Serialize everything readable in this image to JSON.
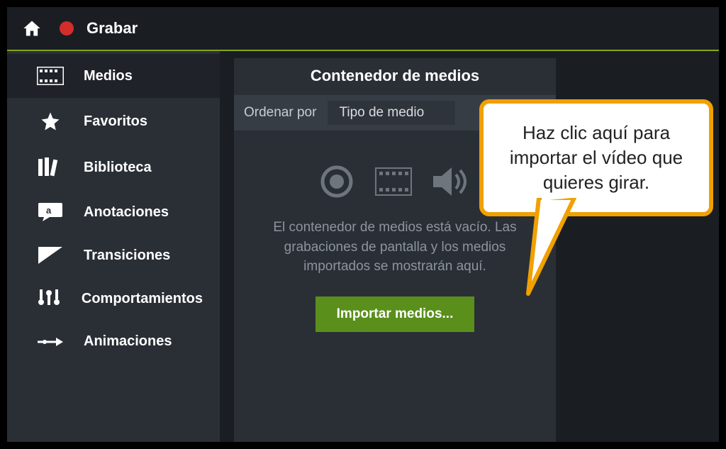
{
  "topbar": {
    "record_label": "Grabar"
  },
  "sidebar": {
    "items": [
      {
        "label": "Medios"
      },
      {
        "label": "Favoritos"
      },
      {
        "label": "Biblioteca"
      },
      {
        "label": "Anotaciones"
      },
      {
        "label": "Transiciones"
      },
      {
        "label": "Comportamientos"
      },
      {
        "label": "Animaciones"
      }
    ]
  },
  "panel": {
    "title": "Contenedor de medios",
    "sort_label": "Ordenar por",
    "sort_value": "Tipo de medio",
    "empty_text": "El contenedor de medios está vacío. Las grabaciones de pantalla y los medios importados se mostrarán aquí.",
    "import_button": "Importar medios..."
  },
  "callout": {
    "text": "Haz clic aquí para importar el vídeo que quieres girar."
  }
}
